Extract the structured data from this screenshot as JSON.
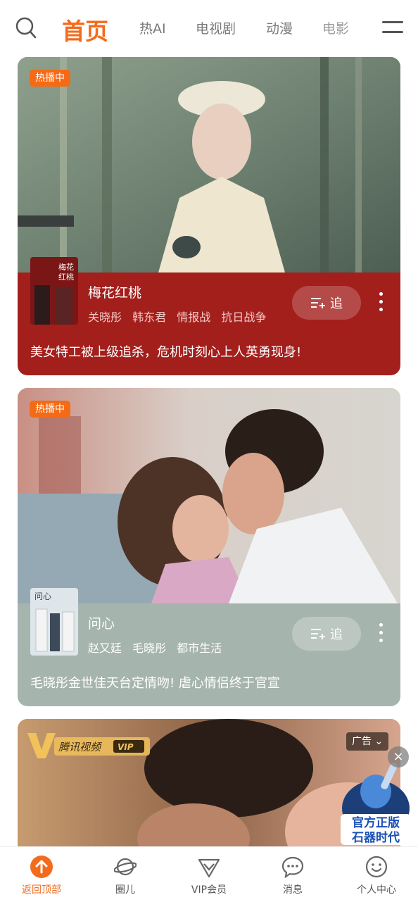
{
  "nav": {
    "tabs": [
      {
        "label": "首页",
        "active": true
      },
      {
        "label": "热AI"
      },
      {
        "label": "电视剧"
      },
      {
        "label": "动漫"
      },
      {
        "label": "电影"
      }
    ]
  },
  "cards": [
    {
      "badge": "热播中",
      "poster_text": "梅花红桃",
      "title": "梅花红桃",
      "tags": [
        "关晓彤",
        "韩东君",
        "情报战",
        "抗日战争"
      ],
      "follow_label": "追",
      "description": "美女特工被上级追杀，危机时刻心上人英勇现身!",
      "theme_color": "#a31f1c"
    },
    {
      "badge": "热播中",
      "poster_text": "问心",
      "title": "问心",
      "tags": [
        "赵又廷",
        "毛晓彤",
        "都市生活"
      ],
      "follow_label": "追",
      "description": "毛晓彤金世佳天台定情吻! 虐心情侣终于官宣",
      "theme_color": "#a6b4ae"
    }
  ],
  "ad": {
    "brand": "腾讯视频",
    "brand_badge": "VIP",
    "label": "广告",
    "close": "×",
    "game_text_line1": "官方正版",
    "game_text_line2": "石器时代"
  },
  "bottom": {
    "items": [
      {
        "label": "返回顶部",
        "icon": "arrow-up-icon",
        "active": true
      },
      {
        "label": "圈儿",
        "icon": "planet-icon"
      },
      {
        "label": "VIP会员",
        "icon": "vip-icon"
      },
      {
        "label": "消息",
        "icon": "message-icon"
      },
      {
        "label": "个人中心",
        "icon": "smile-icon"
      }
    ]
  },
  "colors": {
    "accent": "#f36b1c",
    "badge": "#f56a14"
  }
}
